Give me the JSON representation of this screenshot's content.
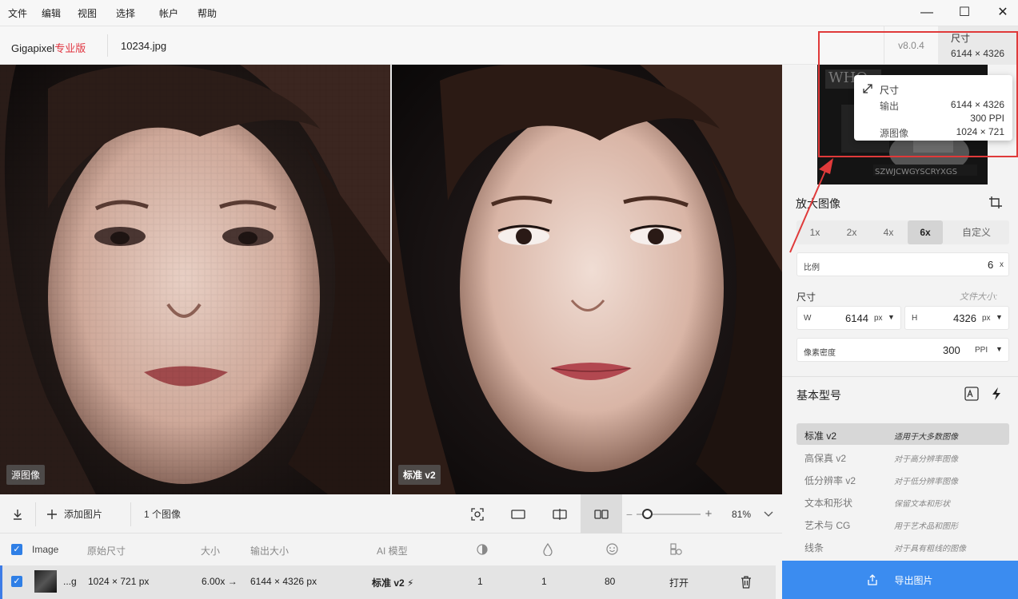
{
  "menu": [
    "文件",
    "编辑",
    "视图",
    "选择",
    "帐户",
    "帮助"
  ],
  "window_controls": {
    "minimize": "—",
    "maximize": "☐",
    "close": "✕"
  },
  "header": {
    "app_name": "Gigapixel",
    "app_edition": "专业版",
    "file_name": "10234.jpg",
    "version": "v8.0.4",
    "size_label": "尺寸",
    "size_value": "6144 × 4326"
  },
  "tooltip": {
    "title": "尺寸",
    "output_label": "输出",
    "output_value": "6144 × 4326",
    "ppi_value": "300 PPI",
    "source_label": "源图像",
    "source_value": "1024 × 721"
  },
  "panes": {
    "left_label": "源图像",
    "right_label": "标准 v2"
  },
  "toolbar": {
    "add_image": "添加图片",
    "image_count": "1 个图像",
    "zoom": "81%",
    "zoom_level": 0.18
  },
  "table": {
    "headers": {
      "image": "Image",
      "original_size": "原始尺寸",
      "scale": "大小",
      "output_size": "输出大小",
      "ai_model": "AI 模型"
    },
    "row": {
      "name": "...g",
      "original_size": "1024 × 721 px",
      "scale": "6.00x →",
      "output_size": "6144 × 4326 px",
      "model": "标准 v2",
      "v1": "1",
      "v2": "1",
      "v3": "80",
      "action": "打开"
    }
  },
  "side": {
    "upscale_title": "放大图像",
    "scales": [
      "1x",
      "2x",
      "4x",
      "6x",
      "自定义"
    ],
    "active_scale": "6x",
    "ratio_label": "比例",
    "ratio_value": "6",
    "ratio_unit": "x",
    "dimension_label": "尺寸",
    "file_size_label": "文件大小:",
    "w_label": "W",
    "w_value": "6144",
    "w_unit": "px",
    "h_label": "H",
    "h_value": "4326",
    "h_unit": "px",
    "density_label": "像素密度",
    "density_value": "300",
    "density_unit": "PPI",
    "model_title": "基本型号",
    "models": [
      {
        "name": "标准 v2",
        "desc": "适用于大多数图像"
      },
      {
        "name": "高保真 v2",
        "desc": "对于高分辨率图像"
      },
      {
        "name": "低分辨率 v2",
        "desc": "对于低分辨率图像"
      },
      {
        "name": "文本和形状",
        "desc": "保留文本和形状"
      },
      {
        "name": "艺术与 CG",
        "desc": "用于艺术品和图形"
      },
      {
        "name": "线条",
        "desc": "对于具有粗线的图像"
      }
    ],
    "export_label": "导出图片"
  }
}
